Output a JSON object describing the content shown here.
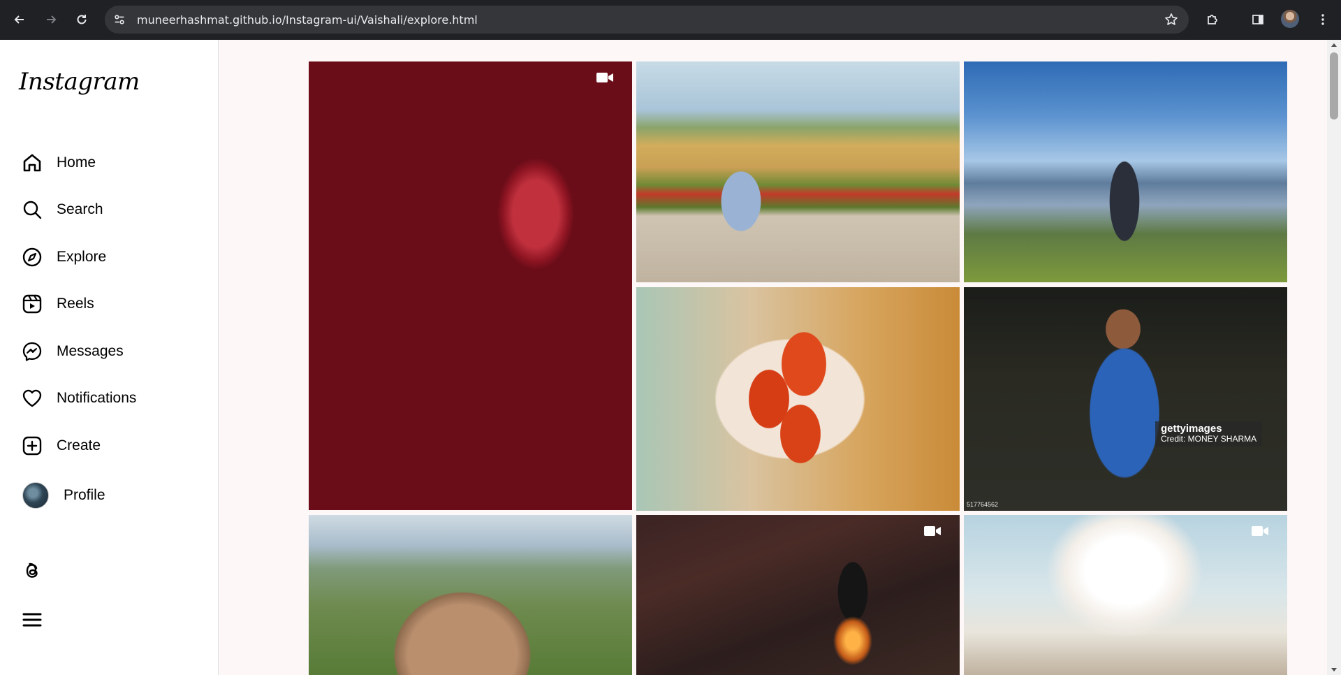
{
  "browser": {
    "url": "muneerhashmat.github.io/Instagram-ui/Vaishali/explore.html",
    "back_icon": "arrow-left-icon",
    "forward_icon": "arrow-right-icon",
    "reload_icon": "reload-icon",
    "site_info_icon": "tune-icon",
    "bookmark_icon": "star-icon",
    "extensions_icon": "puzzle-icon",
    "side_panel_icon": "side-panel-icon",
    "menu_icon": "kebab-menu-icon",
    "chrome_color": "#202124",
    "omnibox_color": "#35363a"
  },
  "sidebar": {
    "logo": "Instagram",
    "items": [
      {
        "label": "Home",
        "icon": "home-icon"
      },
      {
        "label": "Search",
        "icon": "search-icon"
      },
      {
        "label": "Explore",
        "icon": "compass-icon"
      },
      {
        "label": "Reels",
        "icon": "reels-icon"
      },
      {
        "label": "Messages",
        "icon": "messenger-icon"
      },
      {
        "label": "Notifications",
        "icon": "heart-icon"
      },
      {
        "label": "Create",
        "icon": "plus-square-icon"
      },
      {
        "label": "Profile",
        "icon": "avatar"
      }
    ],
    "threads_icon": "threads-icon",
    "more_icon": "hamburger-menu-icon"
  },
  "explore": {
    "background": "#fdf8f7",
    "tiles": [
      {
        "subject": "cricket-ball-on-bat",
        "video": true
      },
      {
        "subject": "girl-sitting-by-poppy-field",
        "video": false
      },
      {
        "subject": "cyclist-on-mountain",
        "video": false
      },
      {
        "subject": "tomatoes-in-hands",
        "video": false
      },
      {
        "subject": "cricketer-in-india-jersey",
        "video": false,
        "watermark": "gettyimages",
        "credit": "Credit: MONEY SHARMA",
        "image_id": "517764562"
      },
      {
        "subject": "hikers-on-rock",
        "video": false
      },
      {
        "subject": "lantern",
        "video": true
      },
      {
        "subject": "bright-sky",
        "video": true
      }
    ]
  }
}
